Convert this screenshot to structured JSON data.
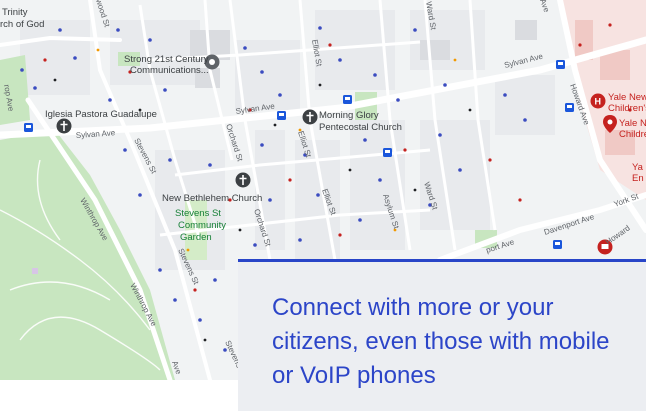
{
  "map": {
    "places": {
      "trinity": [
        "Trinity",
        "rch of God"
      ],
      "strong": [
        "Strong 21st Century",
        "Communications..."
      ],
      "iglesia": "Iglesia Pastora Guadalupe",
      "morning": [
        "Morning Glory",
        "Pentecostal Church"
      ],
      "bethlehem": "New Bethlehem Church",
      "garden": [
        "Stevens St",
        "Community",
        "Garden"
      ],
      "yale1": [
        "Yale New",
        "Children's"
      ],
      "yale2": [
        "Yale Ne",
        "Childre"
      ],
      "ya": [
        "Ya",
        "En"
      ]
    },
    "streets": {
      "sylvan_top": "Sylvan Ave",
      "sylvan_mid": "Sylvan Ave",
      "sylvan_left": "Sylvan Ave",
      "howard": "Howard Ave",
      "howard2": "Howard",
      "winthrop": "Winthrop Ave",
      "winthrop2": "Winthrop Ave",
      "winthrop_top": "rop Ave",
      "davenport": "Davenport Ave",
      "davenport2": "port Ave",
      "york": "York St",
      "asylum": "Asylum St",
      "ward": "Ward St",
      "ward_top": "Ward St",
      "elliot": "Elliot St",
      "elliot_top": "Elliot St",
      "elliot_bot": "Elliot St",
      "orchard": "Orchard St",
      "orchard_bot": "Orchard St",
      "stevens": "Stevens St",
      "stevens2": "Stevens St",
      "stevens3": "Stevens",
      "wood": "wood St",
      "ave_top": "Ave",
      "ave_bot": "Ave"
    }
  },
  "callout": {
    "text": "Connect with more or your citizens, even those with mobile or VoIP phones"
  },
  "colors": {
    "accent": "#2c45c8",
    "callout_bg": "#eceef2",
    "park": "#c8e6c0",
    "hospital": "#c5221f"
  }
}
